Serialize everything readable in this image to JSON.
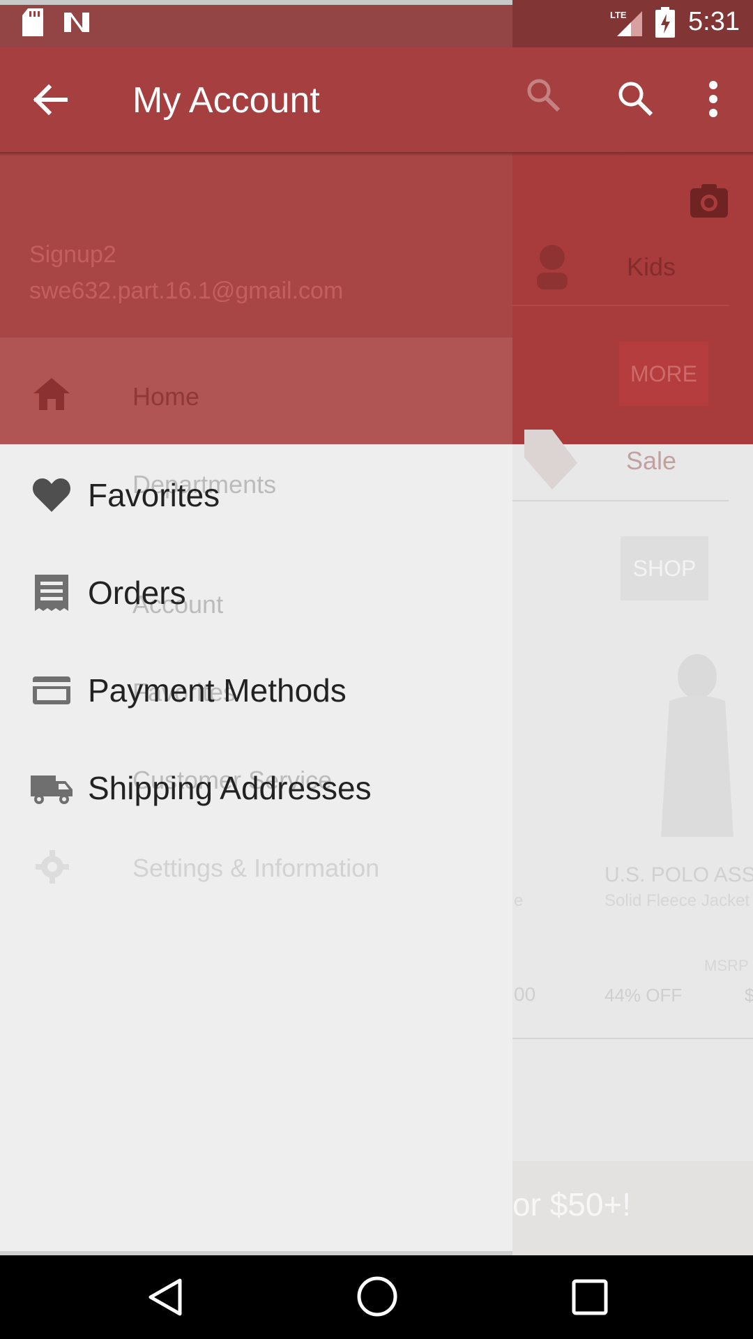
{
  "status_bar": {
    "time": "5:31",
    "network": "LTE"
  },
  "toolbar": {
    "title": "My Account"
  },
  "drawer": {
    "menu_items": [
      {
        "label": "Favorites",
        "icon": "heart-icon"
      },
      {
        "label": "Orders",
        "icon": "receipt-icon"
      },
      {
        "label": "Payment Methods",
        "icon": "credit-card-icon"
      },
      {
        "label": "Shipping Addresses",
        "icon": "truck-icon"
      }
    ],
    "ghost": {
      "user_name": "Signup2",
      "user_email": "swe632.part.16.1@gmail.com",
      "items": [
        "Home",
        "Departments",
        "Account",
        "Favorites",
        "Customer Service",
        "Settings & Information"
      ]
    }
  },
  "background": {
    "category_kids": "Kids",
    "category_sale": "Sale",
    "more_button": "MORE",
    "shop_button": "SHOP",
    "product_brand": "U.S. POLO ASS",
    "product_name": "Solid Fleece Jacket",
    "msrp_label": "MSRP",
    "discount": "44% OFF",
    "price_fragment": "00",
    "letter_fragment": "e",
    "dollar_fragment": "$",
    "banner_text": "or $50+!"
  },
  "colors": {
    "toolbar": "#a63f3f",
    "status_bar": "#823535",
    "drawer_bg": "#eeeeee",
    "menu_text": "#222222",
    "icon_gray": "#6f6f6f"
  }
}
